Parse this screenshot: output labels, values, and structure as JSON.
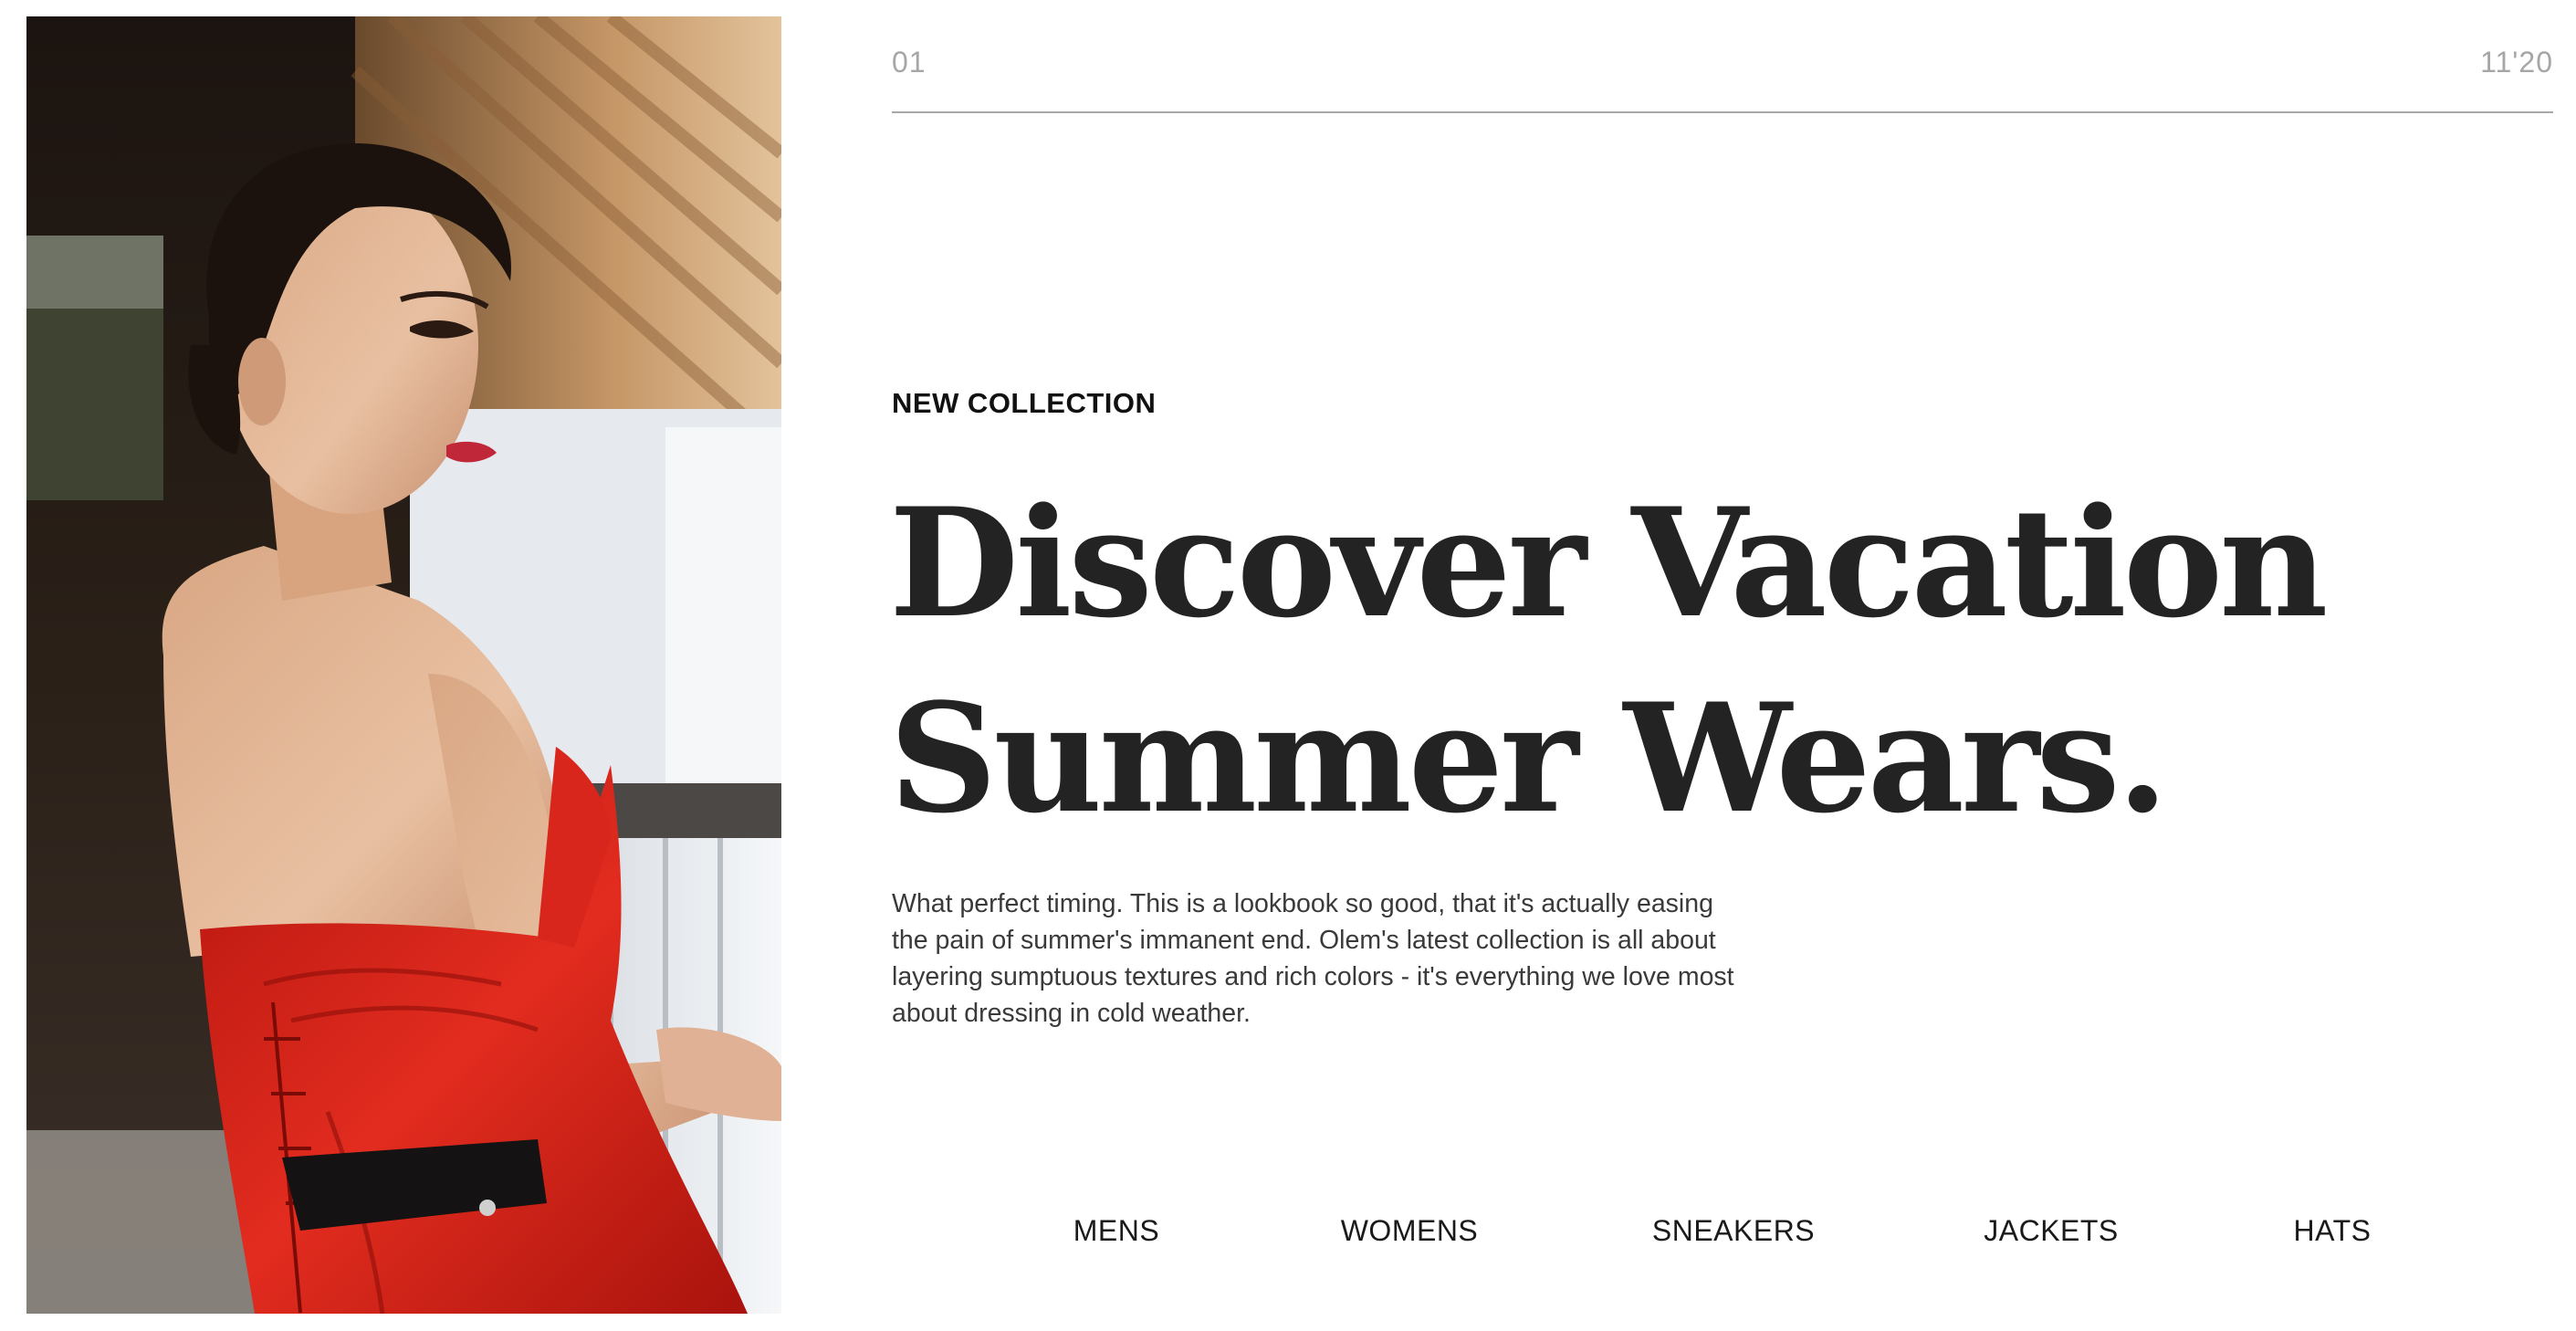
{
  "header": {
    "slide_index": "01",
    "slide_total": "11'20"
  },
  "hero": {
    "eyebrow": "NEW COLLECTION",
    "headline_line1": "Discover Vacation",
    "headline_line2": "Summer Wears.",
    "description": "What perfect timing. This is a lookbook so good, that it's actually easing the pain of summer's immanent end. Olem's latest collection is all about layering sumptuous textures and rich colors - it's everything we love most about dressing in cold weather."
  },
  "nav": {
    "items": [
      {
        "label": "MENS"
      },
      {
        "label": "WOMENS"
      },
      {
        "label": "SNEAKERS"
      },
      {
        "label": "JACKETS"
      },
      {
        "label": "HATS"
      }
    ]
  },
  "colors": {
    "text_dark": "#232323",
    "text_muted": "#a6a6a6",
    "divider": "#a8a8a8",
    "dress_red": "#d9261c"
  }
}
